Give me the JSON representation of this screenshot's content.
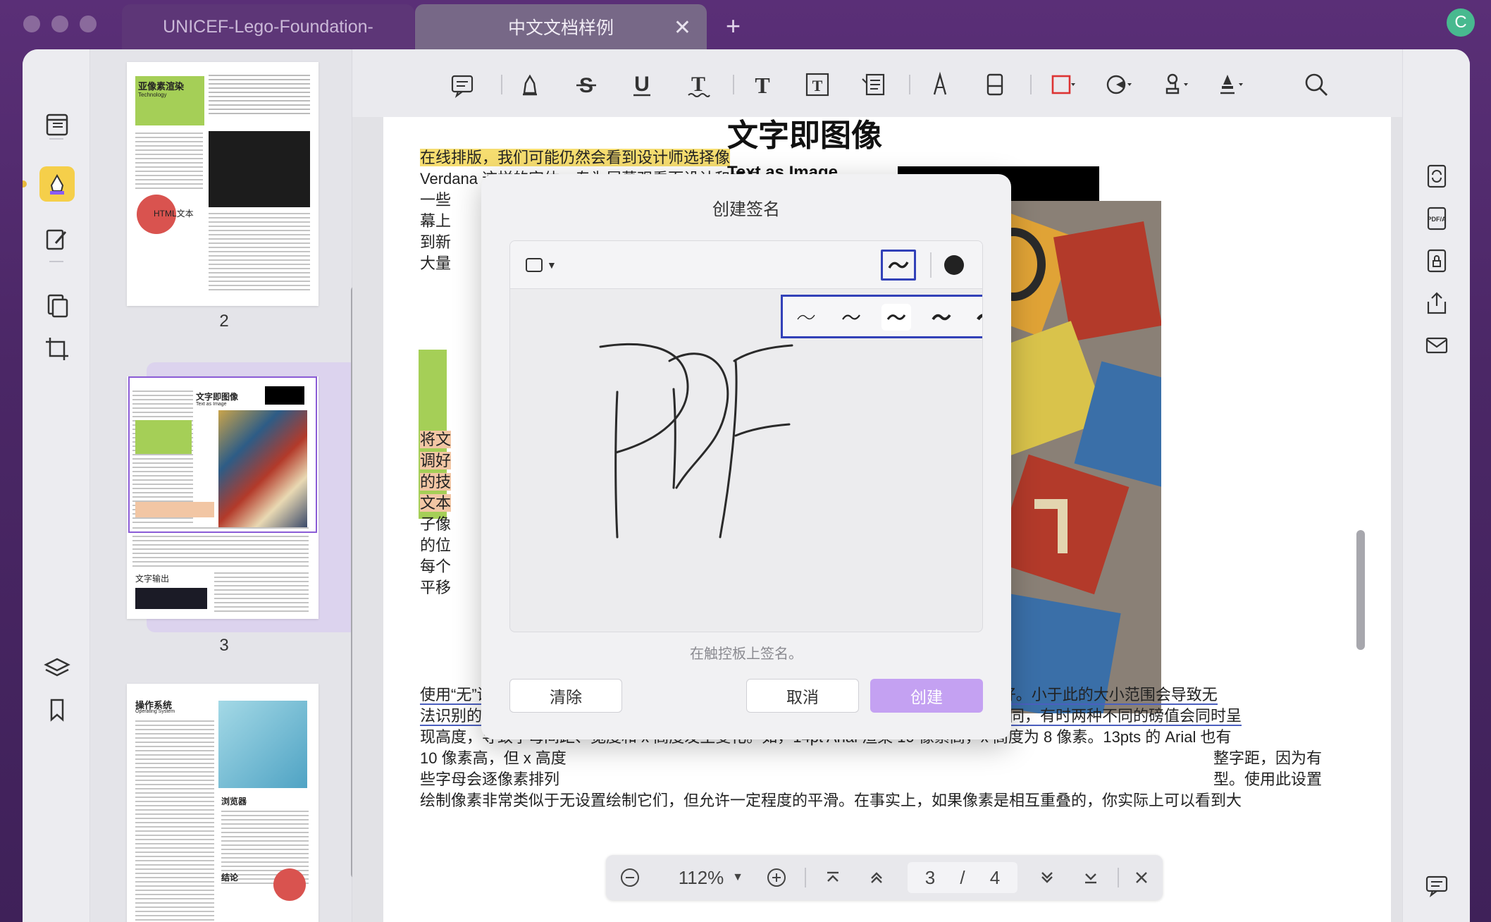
{
  "tabs": [
    {
      "label": "UNICEF-Lego-Foundation-",
      "active": false
    },
    {
      "label": "中文文档样例",
      "active": true
    }
  ],
  "tab_add_label": "+",
  "tab_close_label": "✕",
  "avatar_letter": "C",
  "thumbnails": {
    "pages": [
      {
        "number": "2",
        "heading": "亚像素渲染",
        "sub": "Technology",
        "badge": "HTML文本"
      },
      {
        "number": "3",
        "heading": "文字即图像",
        "sub": "Text as Image",
        "sub2": "文字输出"
      },
      {
        "heading": "操作系统",
        "sub": "Operating System",
        "heading2": "浏览器",
        "heading3": "结论"
      }
    ]
  },
  "document": {
    "lines": [
      {
        "text": "在线排版，我们可能仍然会看到设计师选择像",
        "style": "yellow"
      },
      {
        "text": "Verdana 这样的字体，专为屏幕观看而设计和提示。",
        "style": "plain"
      },
      {
        "text": "一些",
        "style": "plain"
      },
      {
        "text": "幕上",
        "style": "plain"
      },
      {
        "text": "到新",
        "style": "plain"
      },
      {
        "text": "大量",
        "style": "plain"
      }
    ],
    "right_heading": "文字即图像",
    "right_sub": "Text as Image",
    "left_fragments": [
      "将文",
      "调好",
      "的技",
      "文本",
      "子像",
      "的位",
      "每个",
      "平移"
    ],
    "bottom_lines": [
      "使用“无”设置创建的别名文本用途非常有限，并且通常在 9 到 18 点大小之间看起来最好。小于此的大小范围会导致无",
      "法识别的字符，更大的尺寸会导致增加的字符重量和过度锯齿状的边缘。根据字体的不同，有时两种不同的磅值会同时呈",
      "现高度，导致字母间距、宽度和 x 高度发生变化。如，14pt Arial 渲染 10 像素高，x 高度为 8 像素。13pts 的 Arial 也有",
      "10 像素高，但 x 高度",
      "些字母会逐像素排列"
    ],
    "bottom_tail_4": "整字距，因为有",
    "bottom_tail_5": "型。使用此设置",
    "bottom_line_6": "绘制像素非常类似于无设置绘制它们，但允许一定程度的平滑。在事实上，如果像素是相互重叠的，你实际上可以看到大"
  },
  "bottom_nav": {
    "zoom": "112%",
    "current_page": "3",
    "separator": "/",
    "total_pages": "4"
  },
  "dialog": {
    "title": "创建签名",
    "hint": "在触控板上签名。",
    "clear_label": "清除",
    "cancel_label": "取消",
    "create_label": "创建",
    "stroke_options_count": 5,
    "selected_stroke_index": 2,
    "pen_color": "#222222",
    "signature_text": "PDF"
  },
  "colors": {
    "accent": "#3241b8",
    "create_button": "#c4a1f2",
    "highlight_yellow": "#f6dd70",
    "highlight_orange": "#f2c6a4"
  }
}
